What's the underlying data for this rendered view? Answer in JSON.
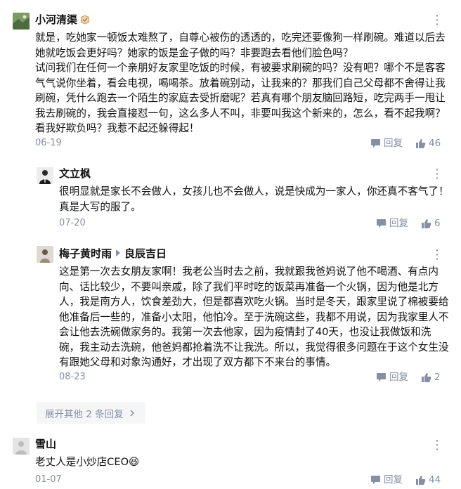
{
  "comments": [
    {
      "author": "小河清渠",
      "paragraphs": [
        "就是，吃她家一顿饭太难熬了，自尊心被伤的透透的，吃完还要像狗一样刷碗。难道以后去她就吃饭会更好吗？她家的饭是金子做的吗？非要跑去看他们脸色吗？",
        "试问我们在任何一个亲朋好友家里吃饭的时候，有被要求刷碗的吗？没有吧？哪个不是客客气气说你坐着，看会电视，喝喝茶。放着碗别动，让我来的？那我们自己父母都不舍得让我刷碗，凭什么跑去一个陌生的家庭去受折磨呢？若真有哪个朋友脑回路短，吃完两手一甩让我去刷碗的，我会直接怼一句，这么多人不叫，非要叫我这个新来的，怎么，看不起我啊？看我好欺负吗？我惹不起还躲得起！"
      ],
      "date": "06-19",
      "reply_label": "回复",
      "likes": "46"
    },
    {
      "author": "文立枫",
      "paragraphs": [
        "很明显就是家长不会做人，女孩儿也不会做人，说是快成为一家人，你还真不客气了！真是大写的服了。"
      ],
      "date": "07-20",
      "reply_label": "回复",
      "likes": "6"
    },
    {
      "author": "梅子黄时雨",
      "reply_to": "良辰吉日",
      "paragraphs": [
        "这是第一次去女朋友家啊！我老公当时去之前，我就跟我爸妈说了他不喝酒、有点内向、话比较少，不要叫亲戚，除了我们平时吃的饭菜再准备一个火锅，因为他是北方人，我是南方人，饮食差劲大，但是都喜欢吃火锅。当时是冬天，跟家里说了棉被要给他准备后一些的，准备小太阳，他怕冷。至于洗碗这些，我都不用说，因为我家里人不会让他去洗碗做家务的。我第一次去他家，因为疫情封了40天，也没让我做饭和洗碗，我主动去洗碗，他爸妈都抢着洗不让我洗。所以，我觉得很多问题在于这个女生没有跟她父母和对象沟通好，才出现了双方都下不来台的事情。"
      ],
      "date": "08-23",
      "reply_label": "回复",
      "likes": "2"
    },
    {
      "author": "雪山",
      "paragraphs": [
        "老丈人是小炒店CEO😆"
      ],
      "date": "01-07",
      "reply_label": "回复",
      "likes": "44"
    }
  ],
  "expand_label": "展开其他 2 条回复",
  "more_glyph": "⋮",
  "icons": {
    "badge": "verified-badge-icon",
    "reply": "reply-bubble-icon",
    "like": "thumbs-up-icon",
    "more": "more-dots-icon",
    "expand": "chevron-right-icon"
  },
  "colors": {
    "muted": "#8590a6",
    "text": "#121212",
    "badge": "#c9a063"
  }
}
